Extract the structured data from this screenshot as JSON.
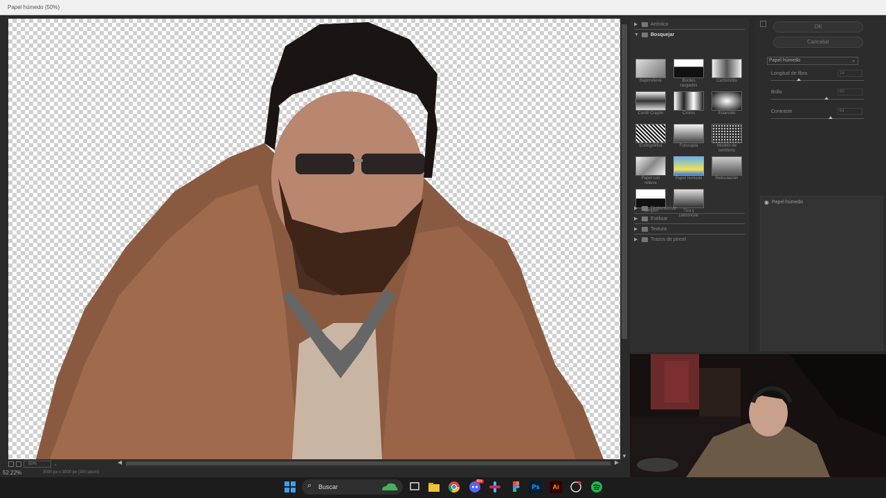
{
  "window": {
    "title": "Papel húmedo (50%)"
  },
  "preview": {
    "zoom_field": "50%"
  },
  "status": {
    "zoom": "52.22%",
    "doc_info": "3000 px x 3000 px (300 ppcm)"
  },
  "gallery": {
    "categories_top": [
      {
        "label": "Artístico",
        "open": false
      },
      {
        "label": "Bosquejar",
        "open": true
      }
    ],
    "thumbs": [
      {
        "label": "Bajorrelieve"
      },
      {
        "label": "Bordes rasgados"
      },
      {
        "label": "Carboncillo"
      },
      {
        "label": "Conté Crayon"
      },
      {
        "label": "Cromo"
      },
      {
        "label": "Estarcido"
      },
      {
        "label": "Estilográfica"
      },
      {
        "label": "Fotocopia"
      },
      {
        "label": "Modelo de semitono"
      },
      {
        "label": "Papel con relieve"
      },
      {
        "label": "Papel húmedo"
      },
      {
        "label": "Reticulación"
      },
      {
        "label": "Tampón"
      },
      {
        "label": "Tiza y carboncillo"
      }
    ],
    "categories_bottom": [
      {
        "label": "Distorsionar"
      },
      {
        "label": "Estilizar"
      },
      {
        "label": "Textura"
      },
      {
        "label": "Trazos de pincel"
      }
    ]
  },
  "settings": {
    "ok_label": "OK",
    "cancel_label": "Cancelar",
    "filter_select": "Papel húmedo",
    "params": [
      {
        "label": "Longitud de fibra",
        "value": "16",
        "level": 0.3
      },
      {
        "label": "Brillo",
        "value": "60",
        "level": 0.6
      },
      {
        "label": "Contraste",
        "value": "64",
        "level": 0.64
      }
    ],
    "layer_label": "Papel húmedo"
  },
  "taskbar": {
    "search_label": "Buscar",
    "apps": [
      "windows-start",
      "task-view",
      "file-explorer",
      "chrome",
      "discord",
      "slack",
      "figma",
      "photoshop",
      "illustrator",
      "github",
      "spotify"
    ],
    "ps_label": "Ps",
    "ai_label": "Ai",
    "discord_badge": "99+"
  }
}
